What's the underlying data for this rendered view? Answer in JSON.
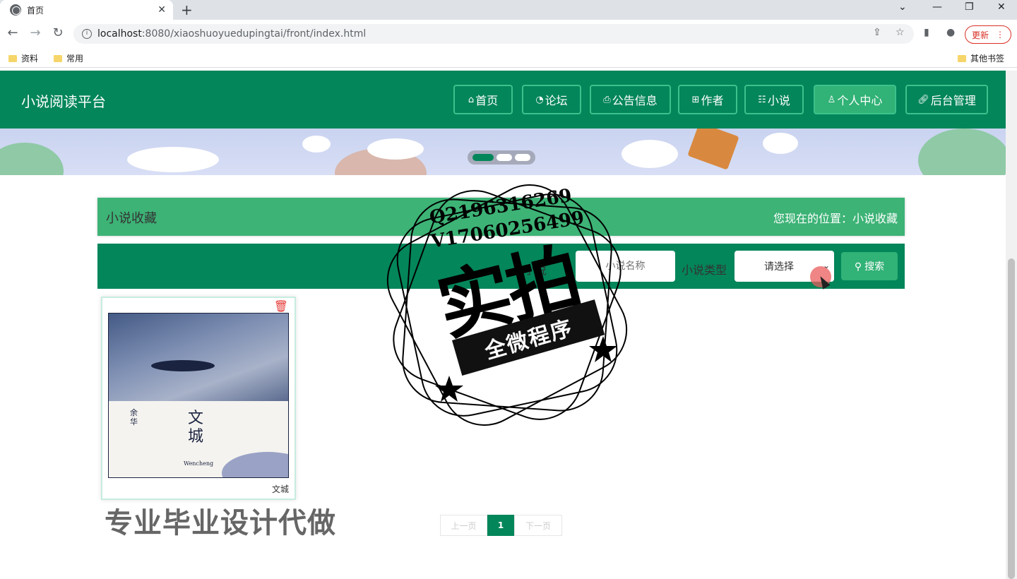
{
  "browser": {
    "tab_title": "首页",
    "url_host": "localhost",
    "url_path": ":8080/xiaoshuoyuedupingtai/front/index.html",
    "update_label": "更新",
    "bookmarks": [
      "资料",
      "常用"
    ],
    "other_bookmarks": "其他书签"
  },
  "site": {
    "title": "小说阅读平台",
    "nav": [
      {
        "label": "首页",
        "icon": "home-icon"
      },
      {
        "label": "论坛",
        "icon": "forum-icon"
      },
      {
        "label": "公告信息",
        "icon": "notice-icon"
      },
      {
        "label": "作者",
        "icon": "author-icon"
      },
      {
        "label": "小说",
        "icon": "book-icon"
      },
      {
        "label": "个人中心",
        "icon": "user-icon"
      },
      {
        "label": "后台管理",
        "icon": "link-icon"
      }
    ],
    "active_nav": "个人中心"
  },
  "page": {
    "section_title": "小说收藏",
    "position_text": "您现在的位置：小说收藏"
  },
  "search": {
    "name_label": "小说",
    "name_placeholder": "小说名称",
    "type_label": "小说类型",
    "type_selected": "请选择",
    "button_label": "搜索"
  },
  "items": [
    {
      "name": "文城",
      "cover_title_1": "文",
      "cover_title_2": "城",
      "cover_author": "余华",
      "cover_en": "Wencheng"
    }
  ],
  "pagination": {
    "prev": "上一页",
    "current": "1",
    "next": "下一页"
  },
  "watermarks": {
    "contact_q": "Q2196316269",
    "contact_v": "V17060256499",
    "big": "实拍",
    "ribbon": "全微程序",
    "bottom": "专业毕业设计代做"
  },
  "colors": {
    "primary": "#03865a",
    "accent": "#31b276",
    "bar": "#3db376"
  }
}
